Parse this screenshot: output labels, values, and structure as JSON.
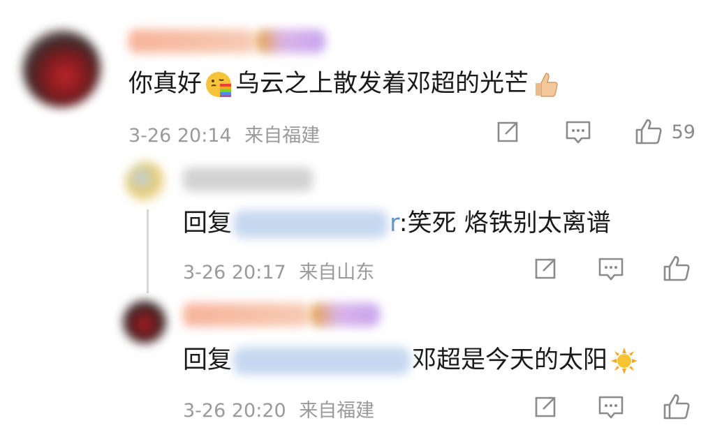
{
  "main_comment": {
    "text_before_emoji": "你真好",
    "emoji_icon": "kissing-face-rainbow-icon",
    "text_after_emoji": "乌云之上散发着邓超的光芒",
    "trailing_emoji_icon": "thumbs-up-emoji-icon",
    "timestamp": "3-26 20:14",
    "location": "来自福建",
    "like_count": "59"
  },
  "reply1": {
    "prefix": "回复",
    "mention_tail": "r",
    "text": ":笑死 烙铁别太离谱",
    "timestamp": "3-26 20:17",
    "location": "来自山东"
  },
  "reply2": {
    "prefix": "回复",
    "text": "邓超是今天的太阳",
    "emoji_icon": "sun-emoji-icon",
    "timestamp": "3-26 20:20",
    "location": "来自福建"
  },
  "colors": {
    "text": "#1a1a1a",
    "meta": "#9a9a9a",
    "mention_blue": "#5b8cc7"
  }
}
